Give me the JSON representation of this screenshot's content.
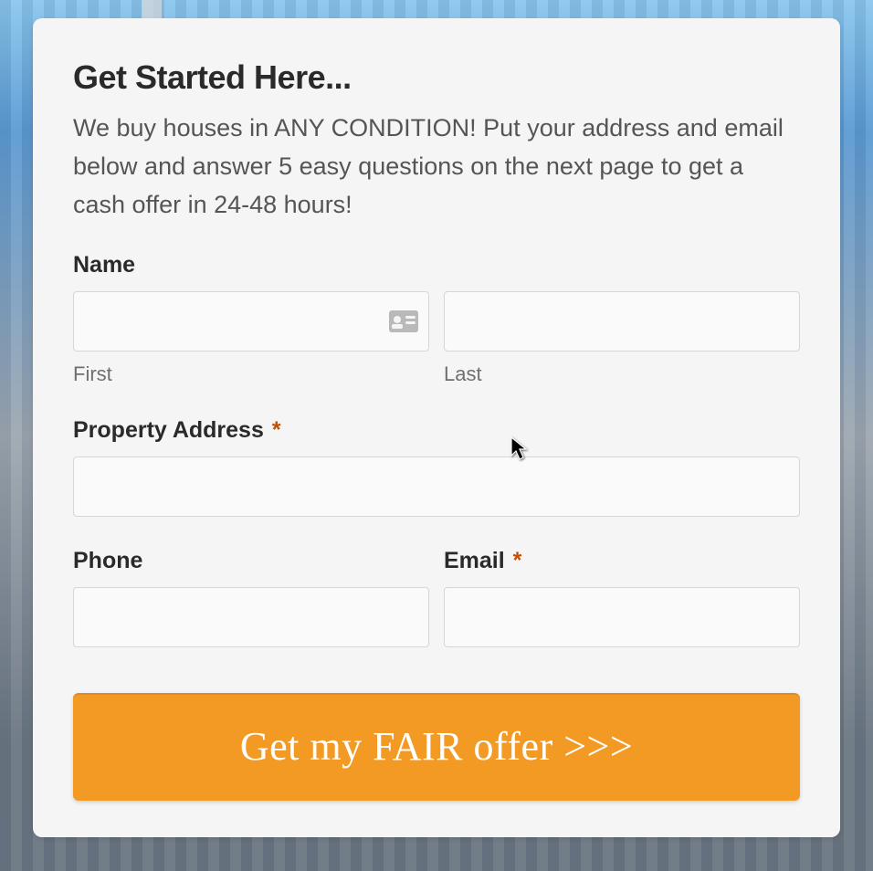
{
  "heading": "Get Started Here...",
  "subtext": "We buy houses in ANY CONDITION! Put your address and email below and answer 5 easy questions on the next page to get a cash offer in 24-48 hours!",
  "fields": {
    "name": {
      "label": "Name",
      "first_sublabel": "First",
      "last_sublabel": "Last",
      "first_value": "",
      "last_value": ""
    },
    "address": {
      "label": "Property Address",
      "required_mark": "*",
      "value": ""
    },
    "phone": {
      "label": "Phone",
      "value": ""
    },
    "email": {
      "label": "Email",
      "required_mark": "*",
      "value": ""
    }
  },
  "submit_label": "Get my FAIR offer >>>",
  "colors": {
    "accent": "#f29a24",
    "required": "#c05000"
  }
}
